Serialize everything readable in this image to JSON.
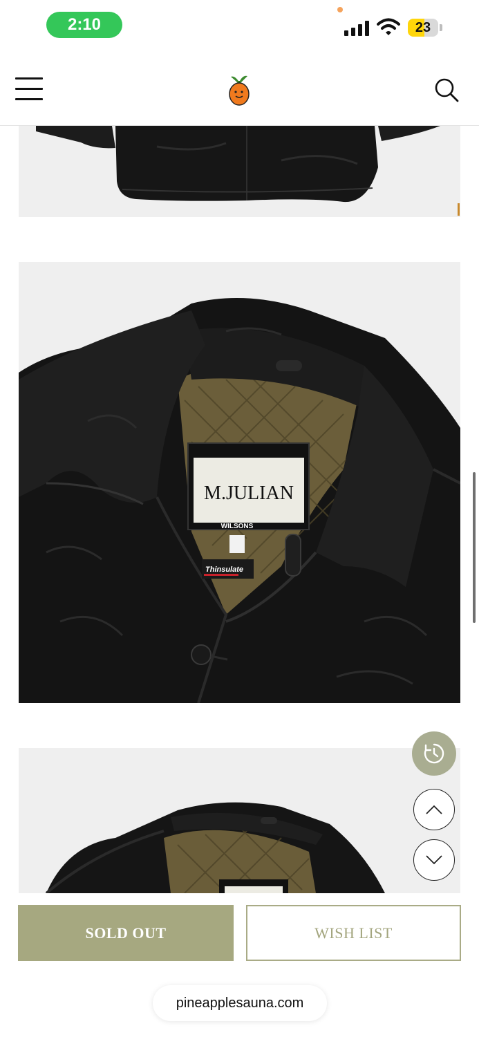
{
  "status_bar": {
    "time": "2:10",
    "battery_level": 23,
    "battery_text": "23",
    "icons": [
      "signal-icon",
      "wifi-icon",
      "battery-icon"
    ]
  },
  "header": {
    "icons": [
      "hamburger-menu-icon",
      "pineapple-sauna-logo",
      "search-icon"
    ]
  },
  "gallery": {
    "label_brand": "M.JULIAN",
    "label_sub": "WILSONS",
    "label_tag": "Thinsulate"
  },
  "floating": {
    "icons": [
      "recently-viewed-clock-icon",
      "scroll-up-chevron-icon",
      "scroll-down-chevron-icon"
    ]
  },
  "actions": {
    "sold_out_label": "SOLD OUT",
    "wish_list_label": "WISH LIST"
  },
  "browser": {
    "url": "pineapplesauna.com"
  },
  "colors": {
    "accent_olive": "#a6a880",
    "status_green": "#34c759",
    "battery_yellow": "#ffd60a"
  }
}
